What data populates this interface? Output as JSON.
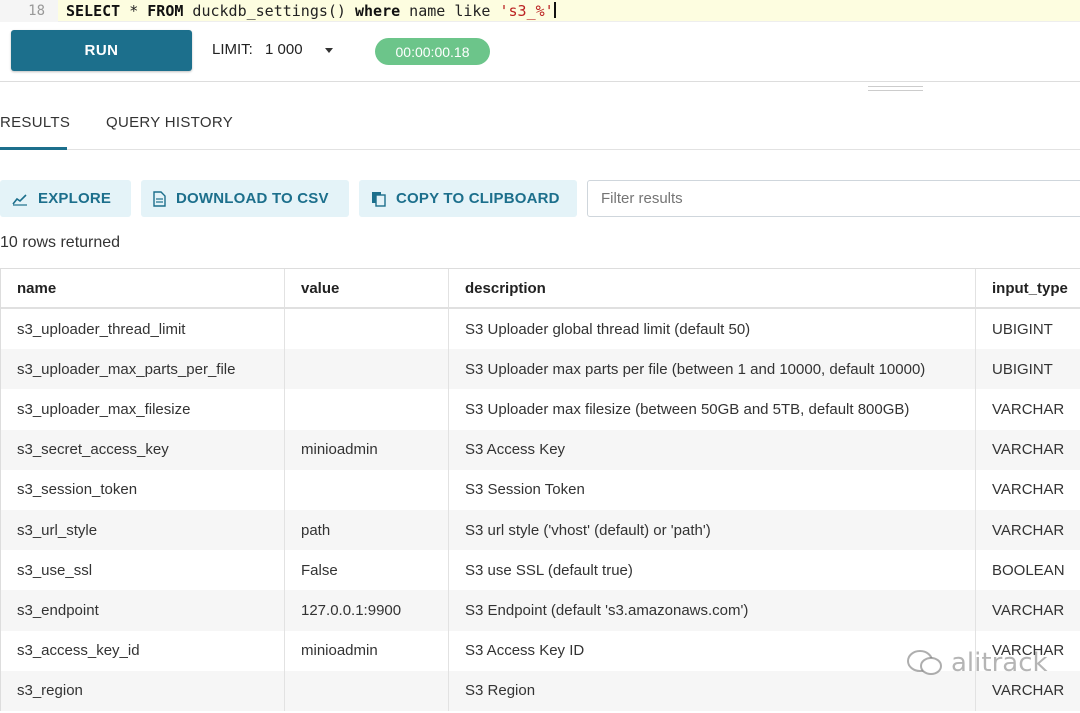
{
  "editor": {
    "line_number": "18",
    "kw1": "SELECT",
    "star": " * ",
    "kw2": "FROM",
    "func": " duckdb_settings()",
    "kw3": " where",
    "name_like": " name like ",
    "literal": "'s3_%'"
  },
  "toolbar": {
    "run_label": "RUN",
    "limit_label": "LIMIT:",
    "limit_value": "1 000",
    "elapsed": "00:00:00.18"
  },
  "tabs": {
    "results": "RESULTS",
    "history": "QUERY HISTORY"
  },
  "actions": {
    "explore": "EXPLORE",
    "download_csv": "DOWNLOAD TO CSV",
    "copy_clipboard": "COPY TO CLIPBOARD",
    "filter_placeholder": "Filter results"
  },
  "results": {
    "row_count": "10 rows returned",
    "columns": [
      "name",
      "value",
      "description",
      "input_type"
    ],
    "rows": [
      [
        "s3_uploader_thread_limit",
        "",
        "S3 Uploader global thread limit (default 50)",
        "UBIGINT"
      ],
      [
        "s3_uploader_max_parts_per_file",
        "",
        "S3 Uploader max parts per file (between 1 and 10000, default 10000)",
        "UBIGINT"
      ],
      [
        "s3_uploader_max_filesize",
        "",
        "S3 Uploader max filesize (between 50GB and 5TB, default 800GB)",
        "VARCHAR"
      ],
      [
        "s3_secret_access_key",
        "minioadmin",
        "S3 Access Key",
        "VARCHAR"
      ],
      [
        "s3_session_token",
        "",
        "S3 Session Token",
        "VARCHAR"
      ],
      [
        "s3_url_style",
        "path",
        "S3 url style ('vhost' (default) or 'path')",
        "VARCHAR"
      ],
      [
        "s3_use_ssl",
        "False",
        "S3 use SSL (default true)",
        "BOOLEAN"
      ],
      [
        "s3_endpoint",
        "127.0.0.1:9900",
        "S3 Endpoint (default 's3.amazonaws.com')",
        "VARCHAR"
      ],
      [
        "s3_access_key_id",
        "minioadmin",
        "S3 Access Key ID",
        "VARCHAR"
      ],
      [
        "s3_region",
        "",
        "S3 Region",
        "VARCHAR"
      ]
    ]
  },
  "watermark": "alitrack",
  "colors": {
    "accent": "#1c6f8c",
    "timer": "#6cc58a",
    "action_bg": "#e4f3f8"
  }
}
